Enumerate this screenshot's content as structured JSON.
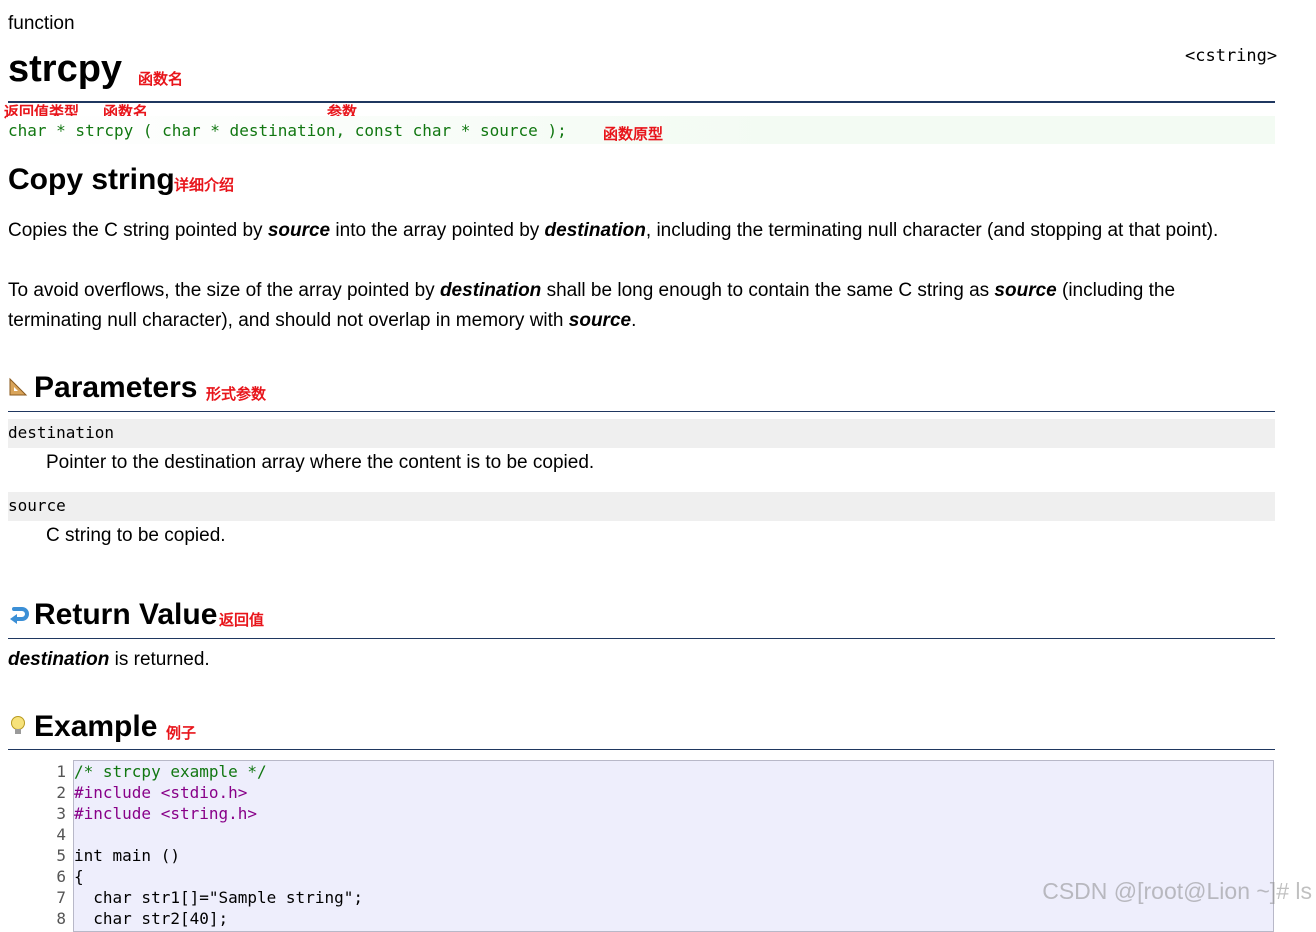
{
  "header": {
    "kind": "function",
    "title": "strcpy",
    "header_file": "<cstring>",
    "title_note": "函数名"
  },
  "prototype": {
    "code": "char * strcpy ( char * destination, const char * source );",
    "note_return_type": "返回值类型",
    "note_func_name": "函数名",
    "note_params": "参数",
    "note_prototype": "函数原型"
  },
  "description": {
    "heading": "Copy string",
    "heading_note": "详细介绍",
    "p1_a": "Copies the C string pointed by ",
    "p1_b": "source",
    "p1_c": " into the array pointed by ",
    "p1_d": "destination",
    "p1_e": ", including the terminating null character (and stopping at that point).",
    "p2_a": "To avoid overflows, the size of the array pointed by ",
    "p2_b": "destination",
    "p2_c": " shall be long enough to contain the same C string as ",
    "p2_d": "source",
    "p2_e": " (including the",
    "p2_f": "terminating null character), and should not overlap in memory with ",
    "p2_g": "source",
    "p2_h": "."
  },
  "parameters": {
    "heading": "Parameters",
    "heading_note": "形式参数",
    "icon": "ruler-triangle-icon",
    "items": [
      {
        "name": "destination",
        "desc": "Pointer to the destination array where the content is to be copied."
      },
      {
        "name": "source",
        "desc": "C string to be copied."
      }
    ]
  },
  "return_value": {
    "heading": "Return Value",
    "heading_note": "返回值",
    "icon": "return-arrow-icon",
    "text_em": "destination",
    "text_rest": " is returned."
  },
  "example": {
    "heading": "Example",
    "heading_note": "例子",
    "icon": "lightbulb-icon",
    "lines": [
      {
        "n": "1",
        "text": "/* strcpy example */"
      },
      {
        "n": "2",
        "text": "#include <stdio.h>"
      },
      {
        "n": "3",
        "text": "#include <string.h>"
      },
      {
        "n": "4",
        "text": ""
      },
      {
        "n": "5",
        "text": "int main ()"
      },
      {
        "n": "6",
        "text": "{"
      },
      {
        "n": "7",
        "text": "  char str1[]=\"Sample string\";"
      },
      {
        "n": "8",
        "text": "  char str2[40];"
      }
    ]
  },
  "watermark": "CSDN @[root@Lion ~]# ls"
}
